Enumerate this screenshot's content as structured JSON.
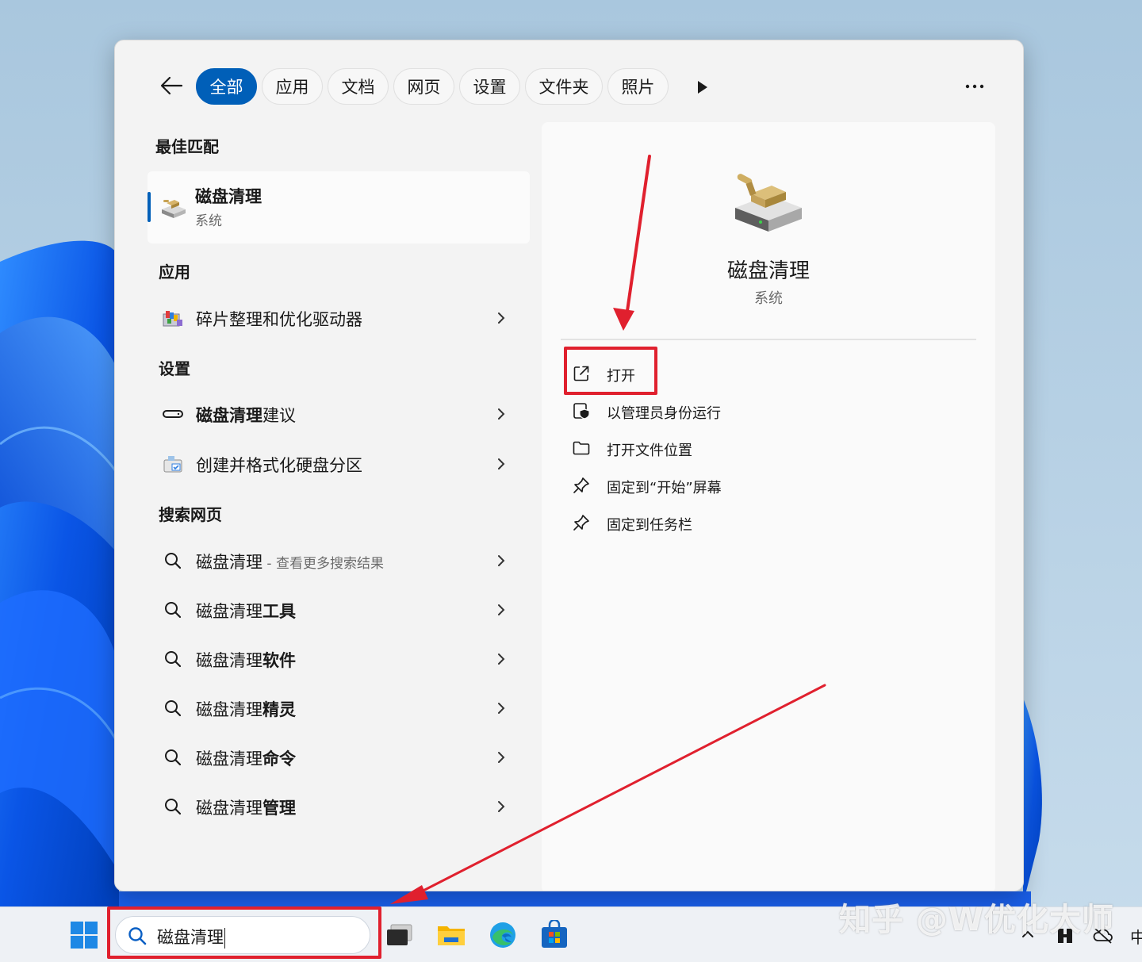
{
  "filter_tabs": [
    "全部",
    "应用",
    "文档",
    "网页",
    "设置",
    "文件夹",
    "照片"
  ],
  "sections": {
    "best_match": "最佳匹配",
    "apps": "应用",
    "settings": "设置",
    "web": "搜索网页"
  },
  "best_match": {
    "title": "磁盘清理",
    "subtitle": "系统"
  },
  "apps": [
    {
      "label": "碎片整理和优化驱动器"
    }
  ],
  "settings": [
    {
      "bold": "磁盘清理",
      "rest": "建议"
    },
    {
      "bold": "",
      "rest": "创建并格式化硬盘分区"
    }
  ],
  "web": [
    {
      "plain": "磁盘清理",
      "bold": "",
      "suffix": " - 查看更多搜索结果"
    },
    {
      "plain": "磁盘清理",
      "bold": "工具",
      "suffix": ""
    },
    {
      "plain": "磁盘清理",
      "bold": "软件",
      "suffix": ""
    },
    {
      "plain": "磁盘清理",
      "bold": "精灵",
      "suffix": ""
    },
    {
      "plain": "磁盘清理",
      "bold": "命令",
      "suffix": ""
    },
    {
      "plain": "磁盘清理",
      "bold": "管理",
      "suffix": ""
    }
  ],
  "preview": {
    "title": "磁盘清理",
    "subtitle": "系统",
    "actions": [
      {
        "label": "打开",
        "icon": "open-external-icon"
      },
      {
        "label": "以管理员身份运行",
        "icon": "admin-shield-icon"
      },
      {
        "label": "打开文件位置",
        "icon": "folder-icon"
      },
      {
        "label": "固定到“开始”屏幕",
        "icon": "pin-icon"
      },
      {
        "label": "固定到任务栏",
        "icon": "pin-icon"
      }
    ]
  },
  "taskbar": {
    "search_value": "磁盘清理",
    "tray_ime": "中"
  },
  "watermark": "知乎 @W优化大师",
  "colors": {
    "accent": "#005fb8",
    "annotation_red": "#e0202e"
  }
}
